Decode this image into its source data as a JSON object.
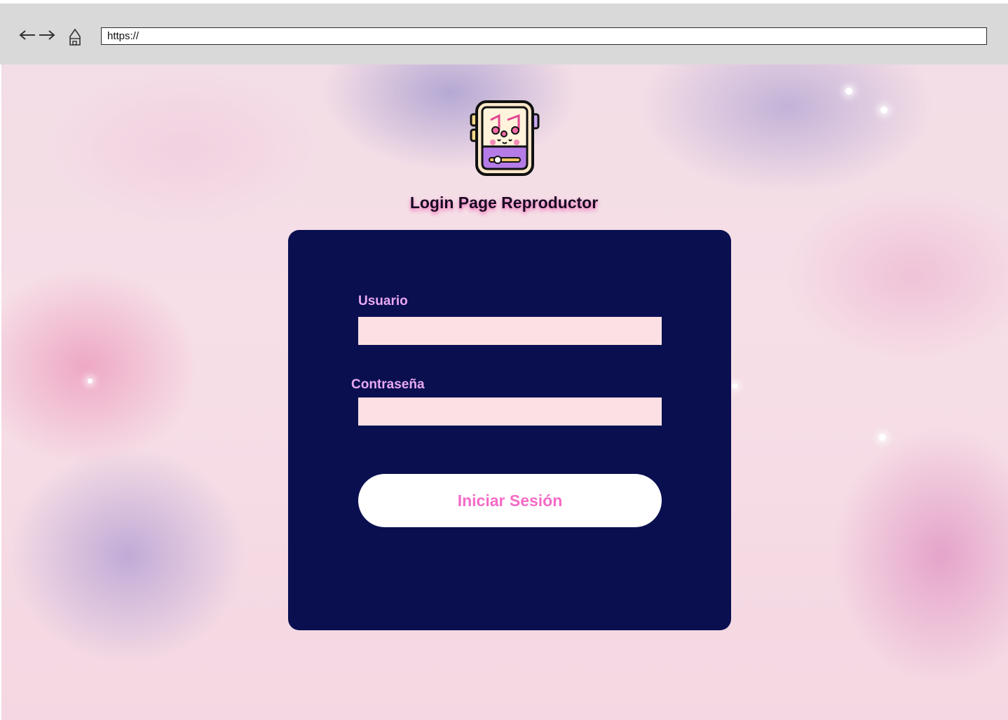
{
  "browser": {
    "url": "https://",
    "icons": {
      "back": "arrow-left-icon",
      "forward": "arrow-right-icon",
      "home": "home-icon"
    }
  },
  "page": {
    "title": "Login Page Reproductor",
    "logo_icon": "music-player-icon"
  },
  "form": {
    "username_label": "Usuario",
    "username_value": "",
    "password_label": "Contraseña",
    "password_value": "",
    "submit_label": "Iniciar Sesión"
  },
  "colors": {
    "card_background": "#0a0f50",
    "label_color": "#e9a9f2",
    "input_background": "#fde0e3",
    "button_text": "#f46bc6",
    "button_background": "#ffffff",
    "chrome_background": "#d9d9d9"
  }
}
